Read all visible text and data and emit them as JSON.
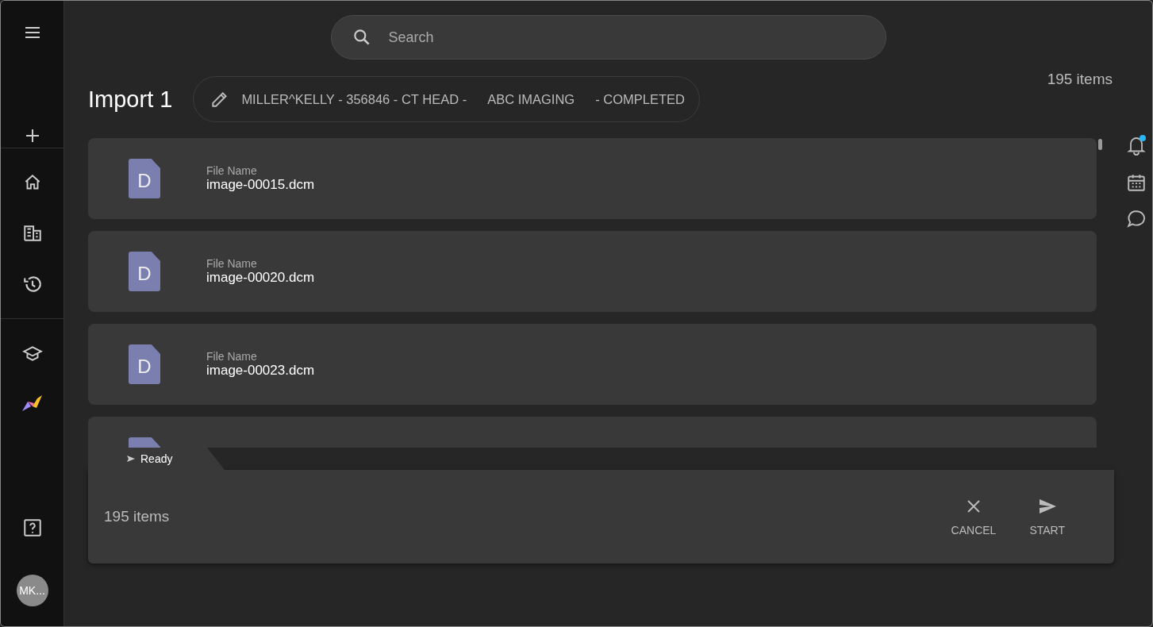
{
  "sidebar": {
    "avatar": "MK..."
  },
  "search": {
    "placeholder": "Search"
  },
  "header": {
    "title": "Import 1",
    "study": [
      "MILLER^KELLY - 356846 - CT HEAD -",
      "ABC IMAGING",
      "- COMPLETED"
    ],
    "count": "195 items"
  },
  "files": [
    {
      "label": "File Name",
      "name": "image-00015.dcm",
      "letter": "D"
    },
    {
      "label": "File Name",
      "name": "image-00020.dcm",
      "letter": "D"
    },
    {
      "label": "File Name",
      "name": "image-00023.dcm",
      "letter": "D"
    }
  ],
  "panel": {
    "status": "Ready",
    "count": "195 items",
    "buttons": [
      {
        "kind": "cancel",
        "label": "CANCEL"
      },
      {
        "kind": "start",
        "label": "START"
      }
    ]
  }
}
